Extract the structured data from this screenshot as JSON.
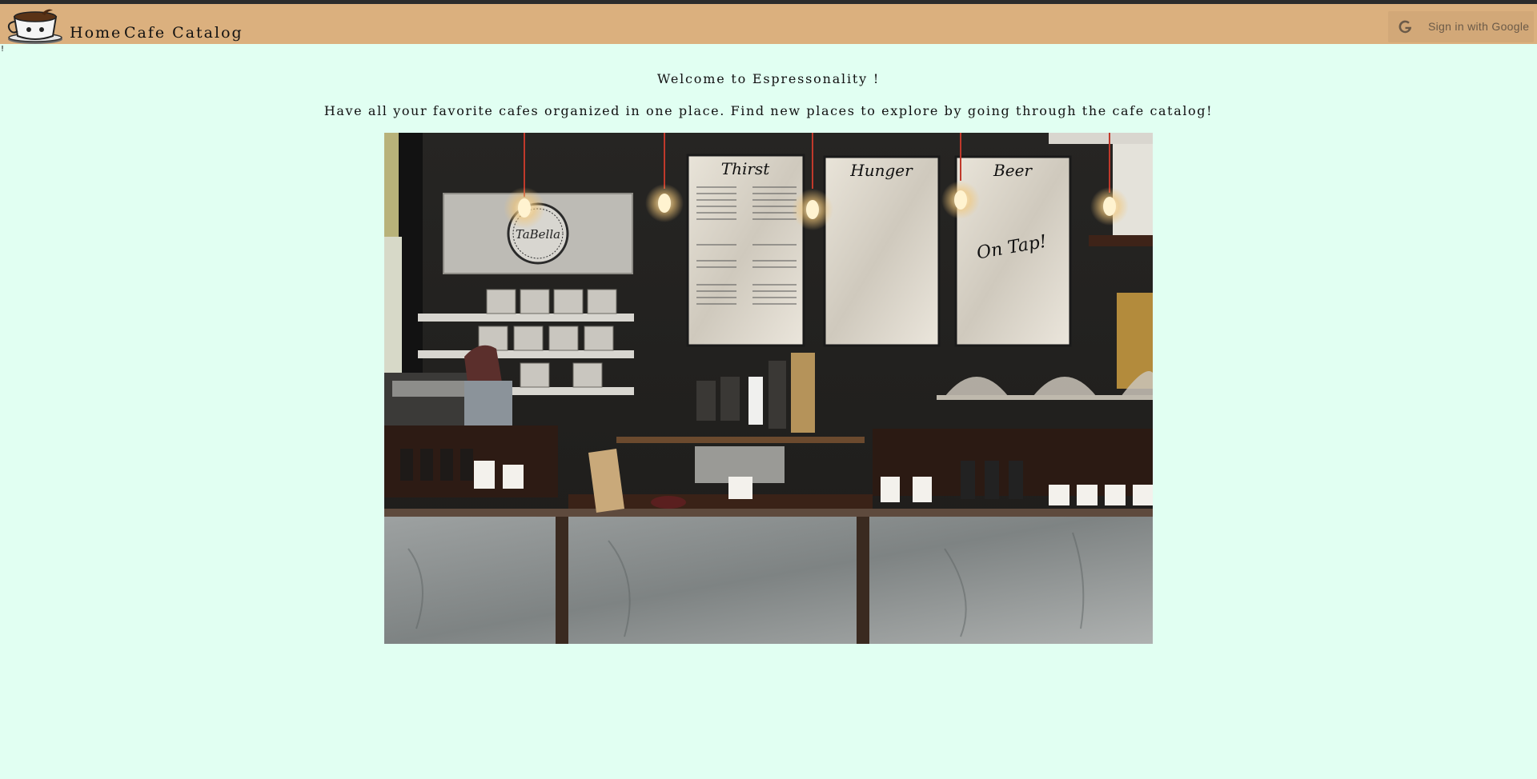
{
  "nav": {
    "home_label": "Home",
    "catalog_label": "Cafe Catalog",
    "signin_label": "Sign in with Google",
    "logo_icon": "coffee-cup-logo-icon"
  },
  "page": {
    "stray_mark": "!",
    "welcome": "Welcome to Espressonality !",
    "tagline": "Have all your favorite cafes organized in one place. Find new places to explore by going through the cafe catalog!"
  },
  "hero": {
    "menu_board_1_title": "Thirst",
    "menu_board_2_title": "Hunger",
    "menu_board_3_title": "Beer",
    "menu_board_3_subtitle": "On Tap!",
    "logo_sign": "TaBella"
  },
  "colors": {
    "navbar": "#dbb07e",
    "background": "#e1fff2",
    "topline": "#2b2b2b"
  }
}
